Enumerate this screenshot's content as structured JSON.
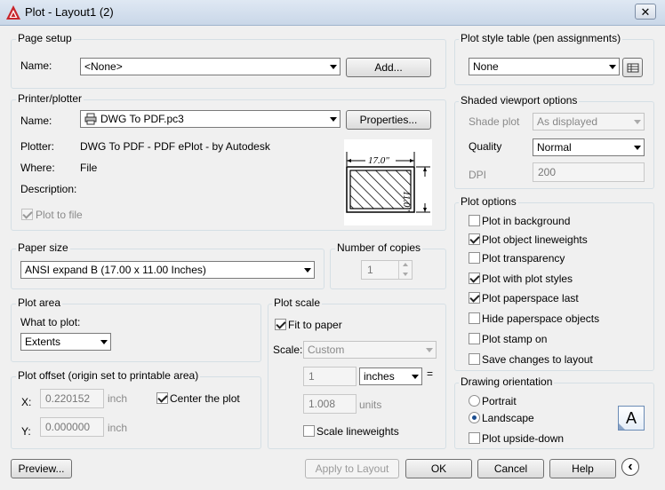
{
  "window": {
    "title": "Plot - Layout1 (2)",
    "close_glyph": "✕"
  },
  "page_setup": {
    "label": "Page setup",
    "name_label": "Name:",
    "name_value": "<None>",
    "add_button": "Add..."
  },
  "printer": {
    "label": "Printer/plotter",
    "name_label": "Name:",
    "name_value": "DWG To PDF.pc3",
    "properties_button": "Properties...",
    "plotter_label": "Plotter:",
    "plotter_value": "DWG To PDF - PDF ePlot - by Autodesk",
    "where_label": "Where:",
    "where_value": "File",
    "description_label": "Description:",
    "plot_to_file": "Plot to file",
    "preview_width": "17.0\"",
    "preview_height": "11.0\""
  },
  "paper_size": {
    "label": "Paper size",
    "value": "ANSI expand B (17.00 x 11.00 Inches)"
  },
  "copies": {
    "label": "Number of copies",
    "value": "1"
  },
  "plot_area": {
    "label": "Plot area",
    "what_label": "What to plot:",
    "what_value": "Extents"
  },
  "plot_offset": {
    "label": "Plot offset (origin set to printable area)",
    "x_label": "X:",
    "x_value": "0.220152",
    "x_unit": "inch",
    "y_label": "Y:",
    "y_value": "0.000000",
    "y_unit": "inch",
    "center": "Center the plot"
  },
  "plot_scale": {
    "label": "Plot scale",
    "fit": "Fit to paper",
    "scale_label": "Scale:",
    "scale_value": "Custom",
    "inches_value": "1",
    "inches_unit": "inches",
    "equals": "=",
    "units_value": "1.008",
    "units_label": "units",
    "scale_lineweights": "Scale lineweights"
  },
  "style_table": {
    "label": "Plot style table (pen assignments)",
    "value": "None"
  },
  "shaded": {
    "label": "Shaded viewport options",
    "shade_label": "Shade plot",
    "shade_value": "As displayed",
    "quality_label": "Quality",
    "quality_value": "Normal",
    "dpi_label": "DPI",
    "dpi_value": "200"
  },
  "plot_options": {
    "label": "Plot options",
    "items": [
      {
        "label": "Plot in background",
        "checked": false
      },
      {
        "label": "Plot object lineweights",
        "checked": true
      },
      {
        "label": "Plot transparency",
        "checked": false
      },
      {
        "label": "Plot with plot styles",
        "checked": true
      },
      {
        "label": "Plot paperspace last",
        "checked": true
      },
      {
        "label": "Hide paperspace objects",
        "checked": false
      },
      {
        "label": "Plot stamp on",
        "checked": false
      },
      {
        "label": "Save changes to layout",
        "checked": false
      }
    ]
  },
  "orientation": {
    "label": "Drawing orientation",
    "portrait": "Portrait",
    "landscape": "Landscape",
    "upside_down": "Plot upside-down",
    "icon_letter": "A"
  },
  "footer": {
    "preview": "Preview...",
    "apply": "Apply to Layout",
    "ok": "OK",
    "cancel": "Cancel",
    "help": "Help",
    "collapse_glyph": "‹"
  }
}
